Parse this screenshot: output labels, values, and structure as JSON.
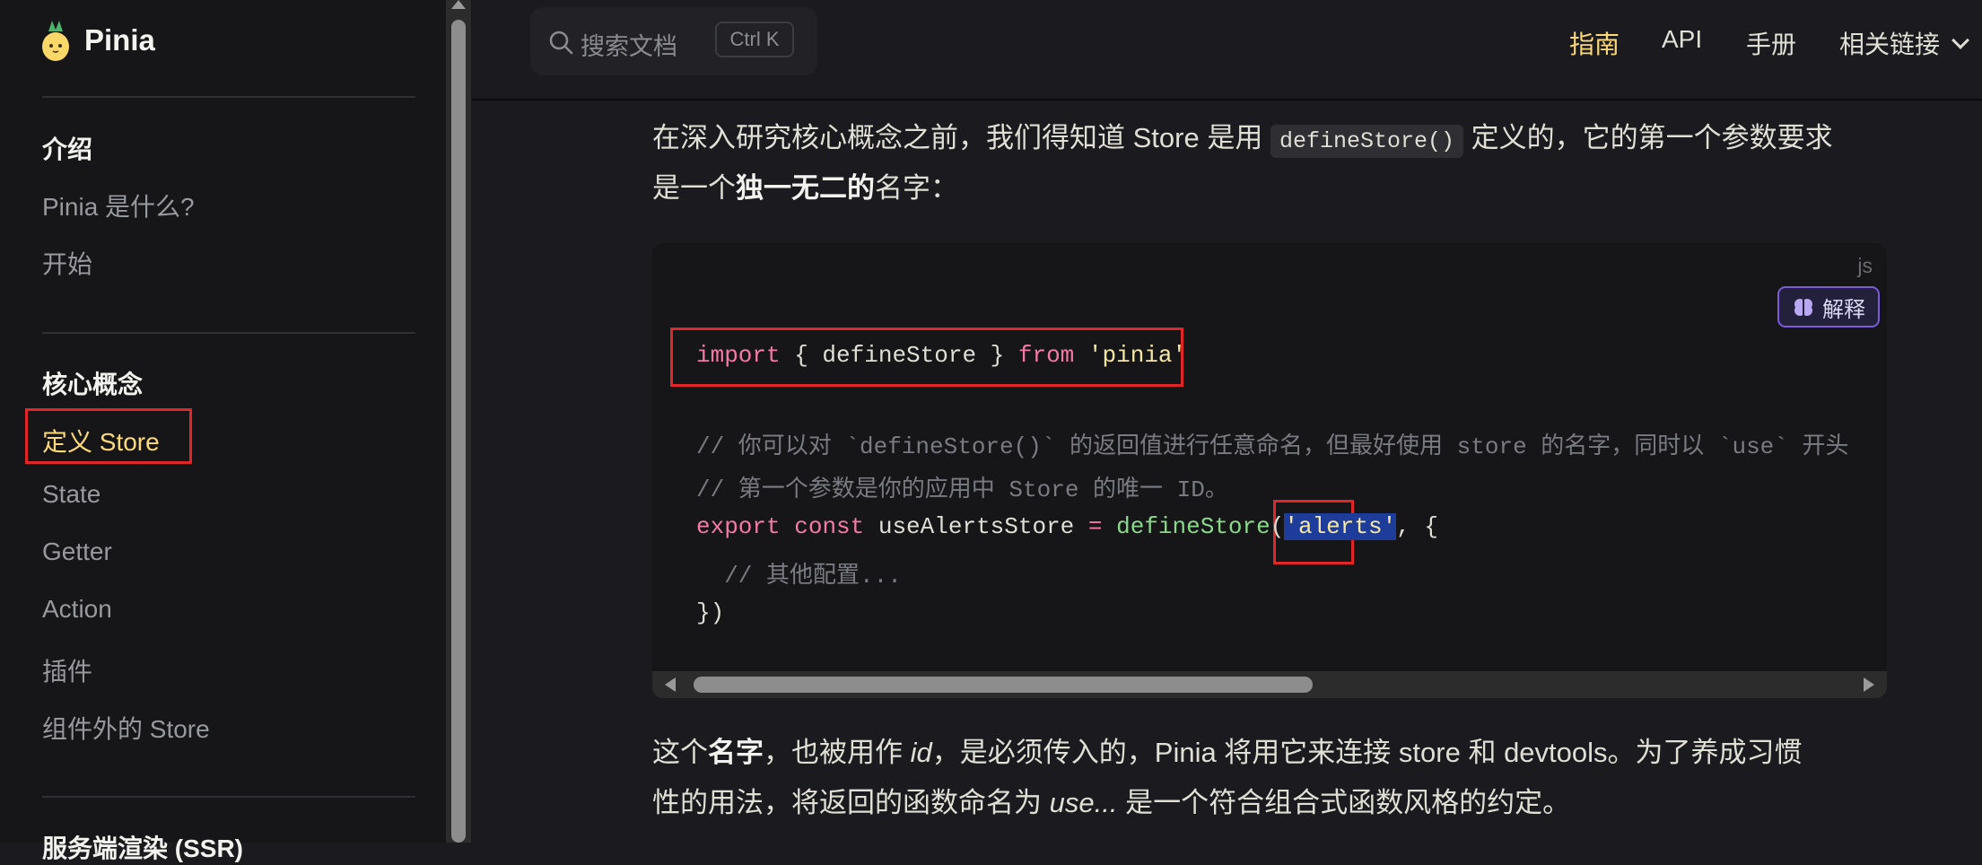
{
  "app": {
    "name": "Pinia"
  },
  "search": {
    "placeholder": "搜索文档",
    "shortcut": "Ctrl K"
  },
  "topnav": {
    "items": [
      "指南",
      "API",
      "手册"
    ],
    "dropdown_label": "相关链接"
  },
  "sidebar": {
    "groups": [
      {
        "title": "介绍",
        "items": [
          "Pinia 是什么?",
          "开始"
        ]
      },
      {
        "title": "核心概念",
        "items": [
          "定义 Store",
          "State",
          "Getter",
          "Action",
          "插件",
          "组件外的 Store"
        ]
      },
      {
        "title": "服务端渲染 (SSR)"
      }
    ],
    "active_item": "定义 Store"
  },
  "content": {
    "intro": {
      "part1": "在深入研究核心概念之前，我们得知道 Store 是用",
      "code": "defineStore()",
      "part2": "定义的，它的第一个参数要求",
      "line2_pre": "是一个",
      "bold": "独一无二的",
      "line2_post": "名字："
    },
    "code_block": {
      "lang": "js",
      "explain_label": "解释",
      "lines": {
        "l1_kw1": "import",
        "l1_mid": " { defineStore } ",
        "l1_kw2": "from",
        "l1_str": "'pinia'",
        "l2": "// 你可以对 `defineStore()` 的返回值进行任意命名，但最好使用 store 的名字，同时以 `use` 开头",
        "l3": "// 第一个参数是你的应用中 Store 的唯一 ID。",
        "l4_kw1": "export",
        "l4_kw2": "const",
        "l4_name": " useAlertsStore ",
        "l4_eq": "=",
        "l4_fn": "defineStore",
        "l4_open": "(",
        "l4_str": "'alerts'",
        "l4_rest": ", {",
        "l5": "  // 其他配置...",
        "l6": "})"
      }
    },
    "outro": {
      "p1": "这个",
      "b1": "名字",
      "p2": "，也被用作",
      "i1": "id",
      "p3": "，是必须传入的，Pinia 将用它来连接 store 和 devtools。为了养成习惯",
      "p4": "性的用法，将返回的函数命名为",
      "i2": "use...",
      "p5": "是一个符合组合式函数风格的约定。"
    }
  },
  "colors": {
    "accent": "#fdd97a",
    "highlight_border": "#e02626",
    "selection": "#1e3c9a",
    "explain_border": "#7a5bd8"
  }
}
